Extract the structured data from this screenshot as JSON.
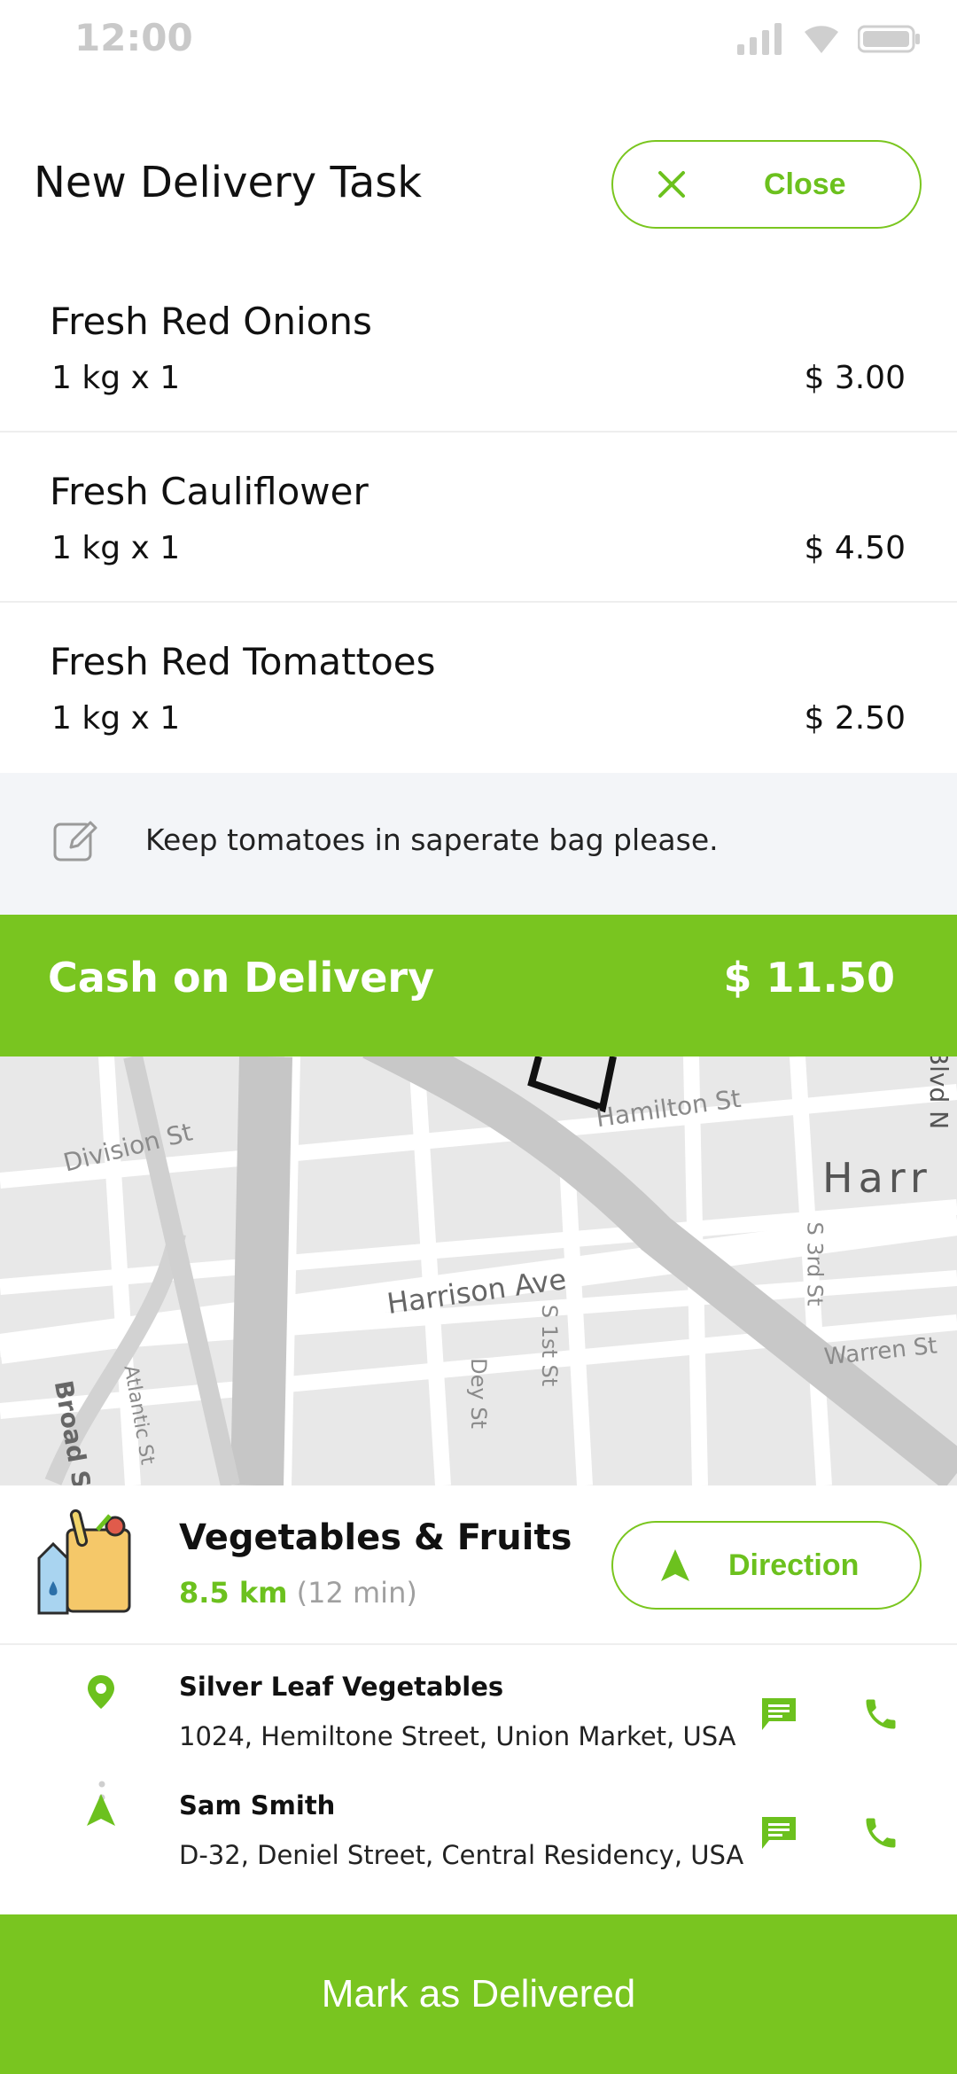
{
  "status_bar": {
    "time": "12:00"
  },
  "header": {
    "title": "New Delivery Task",
    "close_label": "Close"
  },
  "items": [
    {
      "name": "Fresh Red Onions",
      "qty": "1 kg  x  1",
      "price": "$ 3.00"
    },
    {
      "name": "Fresh Cauliflower",
      "qty": "1 kg  x  1",
      "price": "$ 4.50"
    },
    {
      "name": "Fresh Red Tomattoes",
      "qty": "1 kg  x  1",
      "price": "$ 2.50"
    }
  ],
  "note": {
    "text": "Keep tomatoes in saperate bag please."
  },
  "payment": {
    "label": "Cash on Delivery",
    "amount": "$ 11.50"
  },
  "map": {
    "labels": {
      "division": "Division St",
      "hamilton": "Hamilton St",
      "harrison_ave": "Harrison Ave",
      "harr": "Harr",
      "s_3rd": "S 3rd St",
      "warren": "Warren St",
      "s_1st": "S 1st St",
      "dey": "Dey St",
      "atlantic": "Atlantic St",
      "broad": "Broad S",
      "blvd": "Blvd N"
    }
  },
  "store": {
    "name": "Vegetables & Fruits",
    "distance": "8.5 km",
    "eta": "(12 min)",
    "direction_label": "Direction"
  },
  "contacts": [
    {
      "name": "Silver Leaf Vegetables",
      "address": "1024, Hemiltone Street, Union Market, USA"
    },
    {
      "name": "Sam Smith",
      "address": "D-32,  Deniel Street, Central Residency, USA"
    }
  ],
  "actions": {
    "mark_delivered": "Mark as Delivered"
  },
  "colors": {
    "accent": "#79c520",
    "note_bg": "#f3f5f8",
    "map_bg": "#eaeaea"
  },
  "icons": {
    "close": "close-icon",
    "note": "edit-note-icon",
    "direction": "navigation-arrow-icon",
    "pin": "location-pin-icon",
    "message": "message-icon",
    "call": "phone-icon",
    "bag": "grocery-bag-icon"
  }
}
